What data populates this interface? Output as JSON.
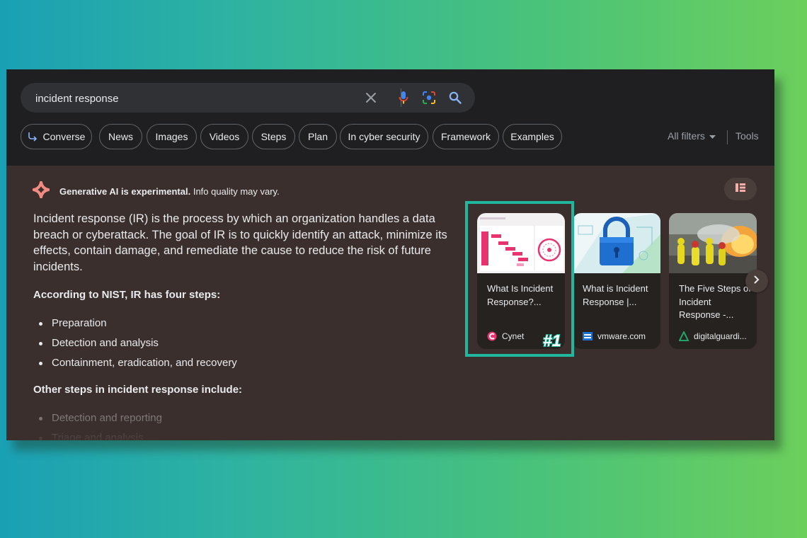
{
  "search": {
    "query": "incident response"
  },
  "chips": [
    {
      "label": "Converse"
    },
    {
      "label": "News"
    },
    {
      "label": "Images"
    },
    {
      "label": "Videos"
    },
    {
      "label": "Steps"
    },
    {
      "label": "Plan"
    },
    {
      "label": "In cyber security"
    },
    {
      "label": "Framework"
    },
    {
      "label": "Examples"
    }
  ],
  "filters": {
    "all_filters": "All filters",
    "tools": "Tools"
  },
  "ai": {
    "label_bold": "Generative AI is experimental.",
    "label_rest": " Info quality may vary.",
    "intro": "Incident response (IR) is the process by which an organization handles a data breach or cyberattack. The goal of IR is to quickly identify an attack, minimize its effects, contain damage, and remediate the cause to reduce the risk of future incidents.",
    "heading1": "According to NIST, IR has four steps:",
    "steps1": [
      "Preparation",
      "Detection and analysis",
      "Containment, eradication, and recovery"
    ],
    "heading2": "Other steps in incident response include:",
    "steps2": [
      "Detection and reporting",
      "Triage and analysis"
    ]
  },
  "cards": [
    {
      "title": "What Is Incident Response?...",
      "source": "Cynet"
    },
    {
      "title": "What is Incident Response |...",
      "source": "vmware.com"
    },
    {
      "title": "The Five Steps of Incident Response -...",
      "source": "digitalguardi..."
    }
  ],
  "badge": "#1",
  "colors": {
    "accent": "#1fb89e",
    "ai_icon": "#f28b82",
    "panel": "#3a2f2c",
    "bar": "#1f1f22"
  }
}
